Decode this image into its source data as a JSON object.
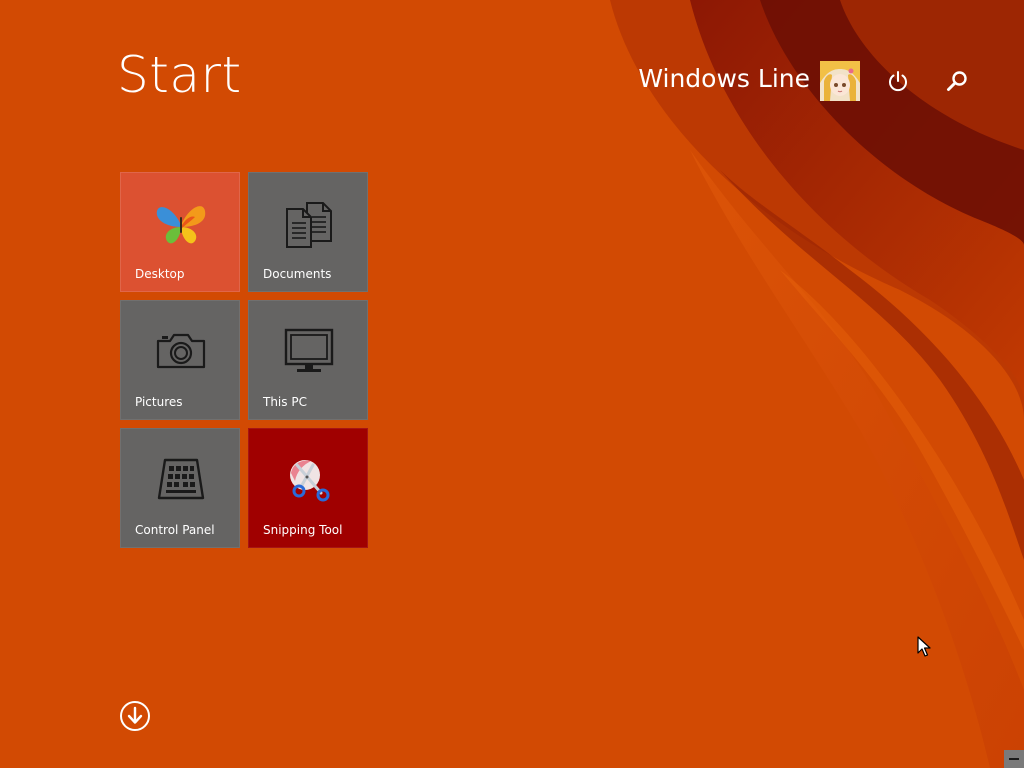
{
  "screen": {
    "title": "Start",
    "background_color": "#d24a03"
  },
  "user": {
    "name": "Windows Line",
    "avatar_icon": "user-avatar"
  },
  "header_actions": {
    "power_icon": "power-icon",
    "search_icon": "search-icon"
  },
  "tiles": [
    {
      "label": "Desktop",
      "icon": "butterfly-icon",
      "color": "#dc5131"
    },
    {
      "label": "Documents",
      "icon": "documents-icon",
      "color": "#656463"
    },
    {
      "label": "Pictures",
      "icon": "camera-icon",
      "color": "#656463"
    },
    {
      "label": "This PC",
      "icon": "monitor-icon",
      "color": "#656463"
    },
    {
      "label": "Control Panel",
      "icon": "control-panel-icon",
      "color": "#656463"
    },
    {
      "label": "Snipping Tool",
      "icon": "scissors-icon",
      "color": "#a00000"
    }
  ],
  "footer": {
    "apps_icon": "down-arrow-circle-icon"
  }
}
